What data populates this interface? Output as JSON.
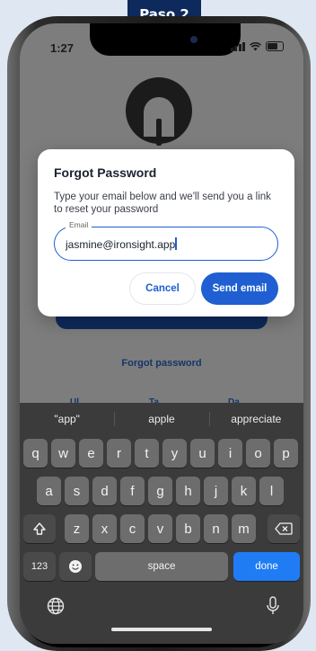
{
  "step_badge": "Paso 2",
  "status": {
    "time": "1:27"
  },
  "dialog": {
    "title": "Forgot Password",
    "description": "Type your email below and we'll send you a link to reset your password",
    "email_label": "Email",
    "email_value": "jasmine@ironsight.app",
    "cancel_label": "Cancel",
    "send_label": "Send email"
  },
  "background": {
    "forgot_link": "Forgot password"
  },
  "keyboard": {
    "suggestions": [
      "\"app\"",
      "apple",
      "appreciate"
    ],
    "row1": [
      "q",
      "w",
      "e",
      "r",
      "t",
      "y",
      "u",
      "i",
      "o",
      "p"
    ],
    "row2": [
      "a",
      "s",
      "d",
      "f",
      "g",
      "h",
      "j",
      "k",
      "l"
    ],
    "row3": [
      "z",
      "x",
      "c",
      "v",
      "b",
      "n",
      "m"
    ],
    "numbers_label": "123",
    "space_label": "space",
    "done_label": "done"
  },
  "colors": {
    "accent": "#1f5fd1",
    "badge": "#0e2a5c",
    "done_key": "#1f7cf5"
  }
}
